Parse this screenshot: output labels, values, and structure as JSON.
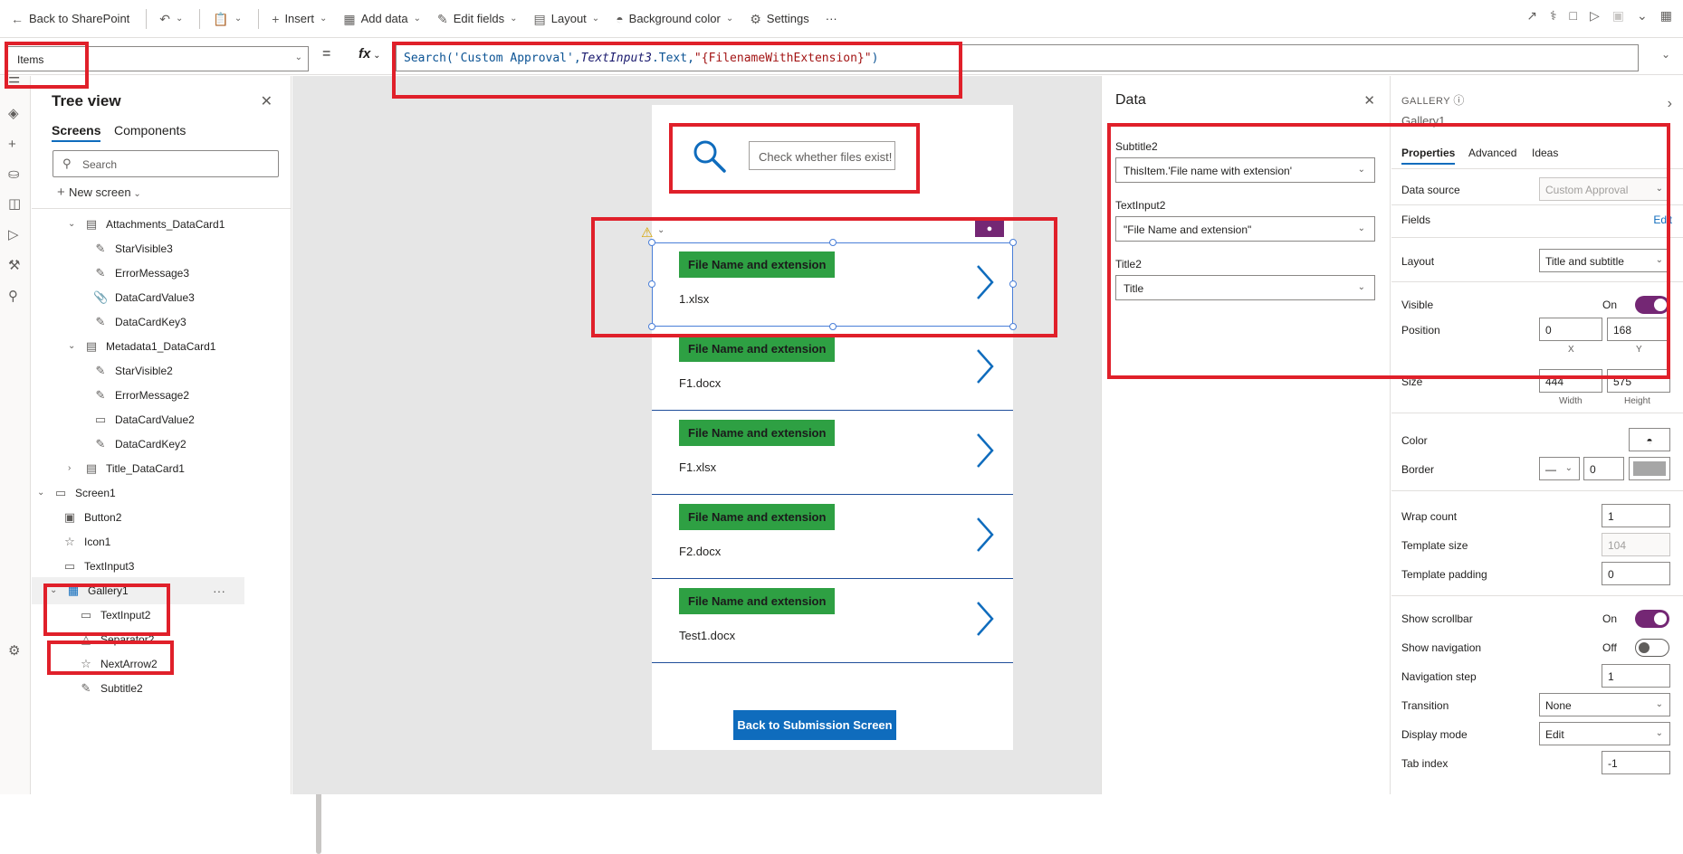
{
  "toolbar": {
    "back": "Back to SharePoint",
    "insert": "Insert",
    "add_data": "Add data",
    "edit_fields": "Edit fields",
    "layout": "Layout",
    "background_color": "Background color",
    "settings": "Settings",
    "more": "···"
  },
  "formula": {
    "property": "Items",
    "equals": "=",
    "fx": "fx",
    "part1": "Search('Custom Approval',",
    "part2": "TextInput3",
    "part3": ".Text,",
    "part4": "\"{FilenameWithExtension}\"",
    "part5": ")"
  },
  "tree": {
    "title": "Tree view",
    "tab_screens": "Screens",
    "tab_components": "Components",
    "search_placeholder": "Search",
    "new_screen": "New screen",
    "rows": [
      "Attachments_DataCard1",
      "StarVisible3",
      "ErrorMessage3",
      "DataCardValue3",
      "DataCardKey3",
      "Metadata1_DataCard1",
      "StarVisible2",
      "ErrorMessage2",
      "DataCardValue2",
      "DataCardKey2",
      "Title_DataCard1",
      "Screen1",
      "Button2",
      "Icon1",
      "TextInput3",
      "Gallery1",
      "TextInput2",
      "Separator2",
      "NextArrow2",
      "Subtitle2"
    ],
    "row_more": "···"
  },
  "canvas": {
    "search_input": "Check whether files exist!",
    "items": [
      {
        "title": "File Name and extension",
        "subtitle": "1.xlsx"
      },
      {
        "title": "File Name and extension",
        "subtitle": "F1.docx"
      },
      {
        "title": "File Name and extension",
        "subtitle": "F1.xlsx"
      },
      {
        "title": "File Name and extension",
        "subtitle": "F2.docx"
      },
      {
        "title": "File Name and extension",
        "subtitle": "Test1.docx"
      }
    ],
    "back_button": "Back to Submission Screen"
  },
  "data_panel": {
    "title": "Data",
    "fields": [
      {
        "label": "Subtitle2",
        "value": "ThisItem.'File name with extension'"
      },
      {
        "label": "TextInput2",
        "value": "\"File Name and extension\""
      },
      {
        "label": "Title2",
        "value": "Title"
      }
    ]
  },
  "properties": {
    "header": "GALLERY",
    "name": "Gallery1",
    "tabs": [
      "Properties",
      "Advanced",
      "Ideas"
    ],
    "data_source_label": "Data source",
    "data_source_value": "Custom Approval",
    "fields_label": "Fields",
    "fields_edit": "Edit",
    "layout_label": "Layout",
    "layout_value": "Title and subtitle",
    "visible_label": "Visible",
    "visible_state": "On",
    "position_label": "Position",
    "position_x": "0",
    "position_y": "168",
    "x_label": "X",
    "y_label": "Y",
    "size_label": "Size",
    "size_width": "444",
    "size_height": "575",
    "width_label": "Width",
    "height_label": "Height",
    "color_label": "Color",
    "border_label": "Border",
    "border_width": "0",
    "wrap_count_label": "Wrap count",
    "wrap_count_value": "1",
    "template_size_label": "Template size",
    "template_size_value": "104",
    "template_padding_label": "Template padding",
    "template_padding_value": "0",
    "show_scrollbar_label": "Show scrollbar",
    "show_scrollbar_state": "On",
    "show_navigation_label": "Show navigation",
    "show_navigation_state": "Off",
    "navigation_step_label": "Navigation step",
    "navigation_step_value": "1",
    "transition_label": "Transition",
    "transition_value": "None",
    "display_mode_label": "Display mode",
    "display_mode_value": "Edit",
    "tab_index_label": "Tab index",
    "tab_index_value": "-1"
  },
  "colors": {
    "accent": "#742774",
    "badge_green": "#2ea043",
    "button_blue": "#0f6cbd",
    "highlight_red": "#e0202a",
    "arrow_blue": "#0f6cbd"
  }
}
